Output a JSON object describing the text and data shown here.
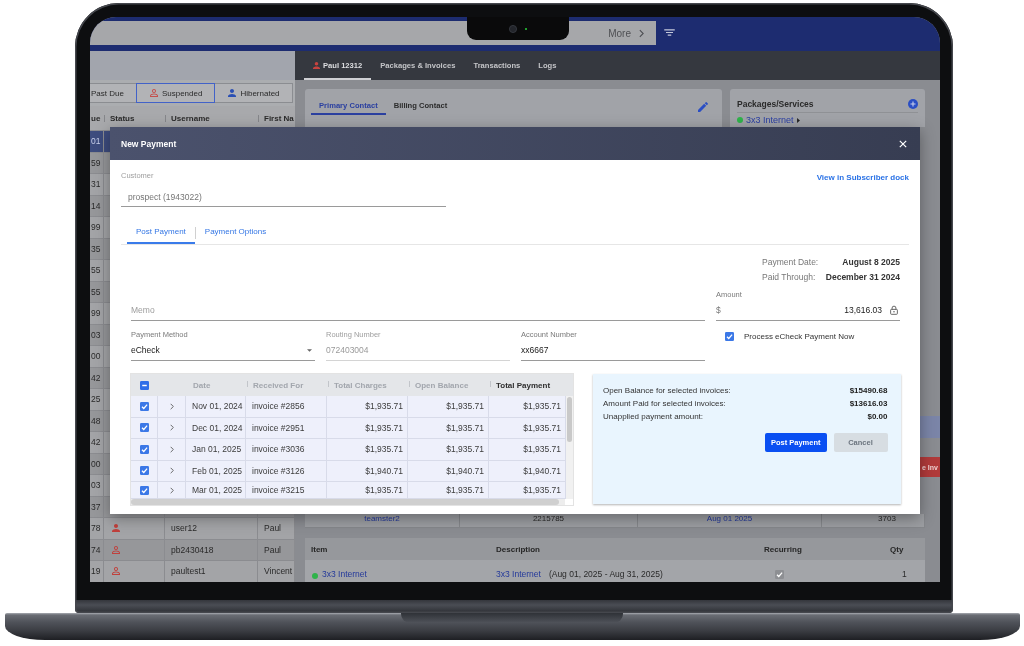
{
  "background_app": {
    "top_bar": {
      "more_label": "More"
    },
    "status_filters": [
      {
        "label": "Past Due",
        "kind": "plain",
        "selected": false
      },
      {
        "label": "Suspended",
        "kind": "outline",
        "selected": true
      },
      {
        "label": "Hibernated",
        "kind": "solid",
        "selected": false
      }
    ],
    "subscriber_table": {
      "columns": [
        "ue",
        "Status",
        "Username",
        "First Na"
      ],
      "rows": [
        {
          "column_1": "01",
          "selected": true
        },
        {
          "column_1": "59",
          "selected": false
        },
        {
          "column_1": "31",
          "selected": false
        },
        {
          "column_1": "14",
          "selected": false
        },
        {
          "column_1": "99",
          "selected": false
        },
        {
          "column_1": "35",
          "selected": false
        },
        {
          "column_1": "55",
          "selected": false
        },
        {
          "column_1": "55",
          "selected": false
        },
        {
          "column_1": "99",
          "selected": false
        },
        {
          "column_1": "03",
          "selected": false
        },
        {
          "column_1": "00",
          "selected": false
        },
        {
          "column_1": "42",
          "selected": false
        },
        {
          "column_1": "25",
          "selected": false
        },
        {
          "column_1": "48",
          "selected": false
        },
        {
          "column_1": "42",
          "selected": false
        },
        {
          "column_1": "00",
          "selected": false
        },
        {
          "column_1": "03",
          "selected": false
        },
        {
          "column_1": "37",
          "selected": false
        },
        {
          "column_1": "78",
          "kind": "solid",
          "username": "user12",
          "first_name": "Paul",
          "selected": false
        },
        {
          "column_1": "74",
          "kind": "outline",
          "username": "pb2430418",
          "first_name": "Paul",
          "selected": false
        },
        {
          "column_1": "19",
          "kind": "outline",
          "username": "paultest1",
          "first_name": "Vincent",
          "selected": false
        }
      ]
    },
    "customer_tabs": [
      {
        "label": "Paul 12312",
        "selected": true
      },
      {
        "label": "Packages & Invoices",
        "selected": false
      },
      {
        "label": "Transactions",
        "selected": false
      },
      {
        "label": "Logs",
        "selected": false
      }
    ],
    "contact_tabs": [
      {
        "label": "Primary Contact",
        "selected": true
      },
      {
        "label": "Billing Contact",
        "selected": false
      }
    ],
    "packages": {
      "title": "Packages/Services",
      "items": [
        {
          "name": "3x3 Internet",
          "color": "#2fb34a"
        }
      ]
    },
    "invoice_button": {
      "label": "e Inv"
    },
    "subscription_row": [
      {
        "text": "teamster2",
        "kind": "link"
      },
      {
        "text": "2215785",
        "kind": "text"
      },
      {
        "text": "Aug 01 2025",
        "kind": "link"
      },
      {
        "text": "3703",
        "kind": "text"
      }
    ],
    "items_table": {
      "columns": [
        "Item",
        "Description",
        "Recurring",
        "Qty"
      ],
      "rows": [
        {
          "item": "3x3 Internet",
          "color": "#2fb34a",
          "description_link": "3x3 Internet",
          "description_period": "(Aug 01, 2025 - Aug 31, 2025)",
          "recurring": true,
          "qty": "1"
        }
      ]
    }
  },
  "dialog": {
    "title": "New Payment",
    "customer": {
      "label": "Customer",
      "value": "prospect (1943022)",
      "disabled": true
    },
    "subscriber_link": "View in Subscriber dock",
    "tabs": [
      {
        "label": "Post Payment",
        "selected": true
      },
      {
        "label": "Payment Options",
        "selected": false
      }
    ],
    "dates": [
      {
        "label": "Payment Date:",
        "value": "August 8 2025"
      },
      {
        "label": "Paid Through:",
        "value": "December 31 2024"
      }
    ],
    "memo": {
      "placeholder": "Memo"
    },
    "amount": {
      "label": "Amount",
      "prefix": "$",
      "value": "13,616.03",
      "locked": true
    },
    "payment_method": {
      "label": "Payment Method",
      "value": "eCheck"
    },
    "routing_number": {
      "label": "Routing Number",
      "value": "072403004",
      "disabled": true
    },
    "account_number": {
      "label": "Account Number",
      "value": "xx6667",
      "disabled": false
    },
    "process_now": {
      "label": "Process eCheck Payment Now",
      "checked": true
    },
    "invoices": {
      "select_all": {
        "checked": false,
        "indeterminate": true
      },
      "columns": [
        {
          "label": "Date",
          "highlighted": false
        },
        {
          "label": "Received For",
          "highlighted": false
        },
        {
          "label": "Total Charges",
          "highlighted": false
        },
        {
          "label": "Open Balance",
          "highlighted": false
        },
        {
          "label": "Total Payment",
          "highlighted": true
        }
      ],
      "rows": [
        {
          "checked": true,
          "expanded": false,
          "date": "Nov 01, 2024",
          "received_for": "invoice #2856",
          "total_charges": "$1,935.71",
          "open_balance": "$1,935.71",
          "total_payment": "$1,935.71"
        },
        {
          "checked": true,
          "expanded": false,
          "date": "Dec 01, 2024",
          "received_for": "invoice #2951",
          "total_charges": "$1,935.71",
          "open_balance": "$1,935.71",
          "total_payment": "$1,935.71"
        },
        {
          "checked": true,
          "expanded": false,
          "date": "Jan 01, 2025",
          "received_for": "invoice #3036",
          "total_charges": "$1,935.71",
          "open_balance": "$1,935.71",
          "total_payment": "$1,935.71"
        },
        {
          "checked": true,
          "expanded": false,
          "date": "Feb 01, 2025",
          "received_for": "invoice #3126",
          "total_charges": "$1,940.71",
          "open_balance": "$1,940.71",
          "total_payment": "$1,940.71"
        },
        {
          "checked": true,
          "expanded": false,
          "date": "Mar 01, 2025",
          "received_for": "invoice #3215",
          "total_charges": "$1,935.71",
          "open_balance": "$1,935.71",
          "total_payment": "$1,935.71"
        }
      ]
    },
    "summary": {
      "lines": [
        {
          "label": "Open Balance for selected invoices:",
          "value": "$15490.68"
        },
        {
          "label": "Amount Paid for selected invoices:",
          "value": "$13616.03"
        },
        {
          "label": "Unapplied payment amount:",
          "value": "$0.00"
        }
      ],
      "buttons": [
        {
          "label": "Post Payment",
          "disabled": false
        },
        {
          "label": "Cancel",
          "disabled": true
        }
      ]
    }
  }
}
